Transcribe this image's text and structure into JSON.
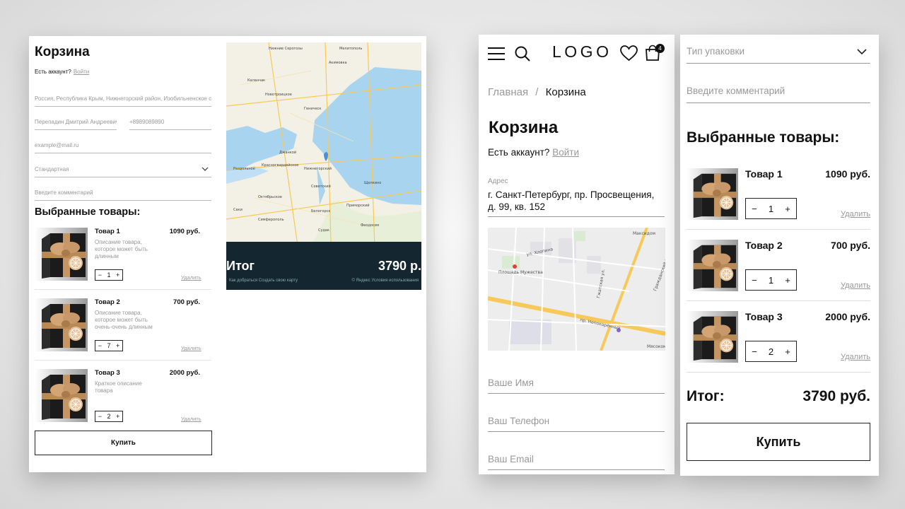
{
  "desktop": {
    "title": "Корзина",
    "account_prompt": "Есть аккаунт?",
    "login_link": "Войти",
    "address_value": "Россия, Республика Крым, Нижнегорский район, Изобильненское се",
    "name_value": "Перепадин Дмитрий Андреевич",
    "phone_value": "+8989089890",
    "email_placeholder": "example@mail.ru",
    "packaging_value": "Стандартная",
    "comment_placeholder": "Введите комментарий",
    "section_title": "Выбранные товары:",
    "items": [
      {
        "name": "Товар 1",
        "price": "1090 руб.",
        "desc": "Описание товара, которое может быть длинным",
        "qty": "1",
        "delete": "Удалить"
      },
      {
        "name": "Товар 2",
        "price": "700 руб.",
        "desc": "Описание товара, которое может быть очень-очень длинным",
        "qty": "7",
        "delete": "Удалить"
      },
      {
        "name": "Товар 3",
        "price": "2000 руб.",
        "desc": "Краткое описание товара",
        "qty": "2",
        "delete": "Удалить"
      }
    ],
    "buy_label": "Купить",
    "total_label": "Итог",
    "total_value": "3790 р.",
    "map_footer_left": "Как добраться",
    "map_footer_mid": "Создать свою карту",
    "map_footer_right": "© Яндекс Условия использования"
  },
  "mobile1": {
    "logo": "LOGO",
    "cart_badge": "4",
    "breadcrumb_home": "Главная",
    "breadcrumb_sep": "/",
    "breadcrumb_current": "Корзина",
    "title": "Корзина",
    "account_prompt": "Есть аккаунт?",
    "login_link": "Войти",
    "address_label": "Адрес",
    "address_value": "г. Санкт-Петербург, пр. Просвещения, д. 99, кв. 152",
    "name_placeholder": "Ваше Имя",
    "phone_placeholder": "Ваш Телефон",
    "email_placeholder": "Ваш Email"
  },
  "mobile2": {
    "packaging_placeholder": "Тип упаковки",
    "comment_placeholder": "Введите комментарий",
    "section_title": "Выбранные товары:",
    "items": [
      {
        "name": "Товар 1",
        "price": "1090 руб.",
        "qty": "1",
        "delete": "Удалить"
      },
      {
        "name": "Товар 2",
        "price": "700 руб.",
        "qty": "1",
        "delete": "Удалить"
      },
      {
        "name": "Товар 3",
        "price": "2000 руб.",
        "qty": "2",
        "delete": "Удалить"
      }
    ],
    "total_label": "Итог:",
    "total_value": "3790 руб.",
    "buy_label": "Купить"
  },
  "steppers": {
    "minus": "−",
    "plus": "+"
  },
  "map_desktop": {
    "labels": [
      "Нижние Серогозы",
      "Мелитополь",
      "Акимовка",
      "Каланчак",
      "Новотроицкое",
      "Геническ",
      "Джанкой",
      "Нижнегорский",
      "Советский",
      "Приморский",
      "Феодосия",
      "Красногвардейское",
      "Октябрьское",
      "Белогорск",
      "Симферополь",
      "Щелкино",
      "Саки",
      "Судак",
      "Раздольное"
    ]
  },
  "map_mobile": {
    "labels": [
      "Площадь Мужества",
      "пр. Непокорённых",
      "Гжатская ул.",
      "Гражданский пр.",
      "ул. Хлопина",
      "Максидом",
      "Мясокомбинат"
    ]
  },
  "colors": {
    "sea": "#a8d4f0",
    "land": "#f3f1e6",
    "road": "#f7c95a",
    "total_bar": "#14262f"
  }
}
